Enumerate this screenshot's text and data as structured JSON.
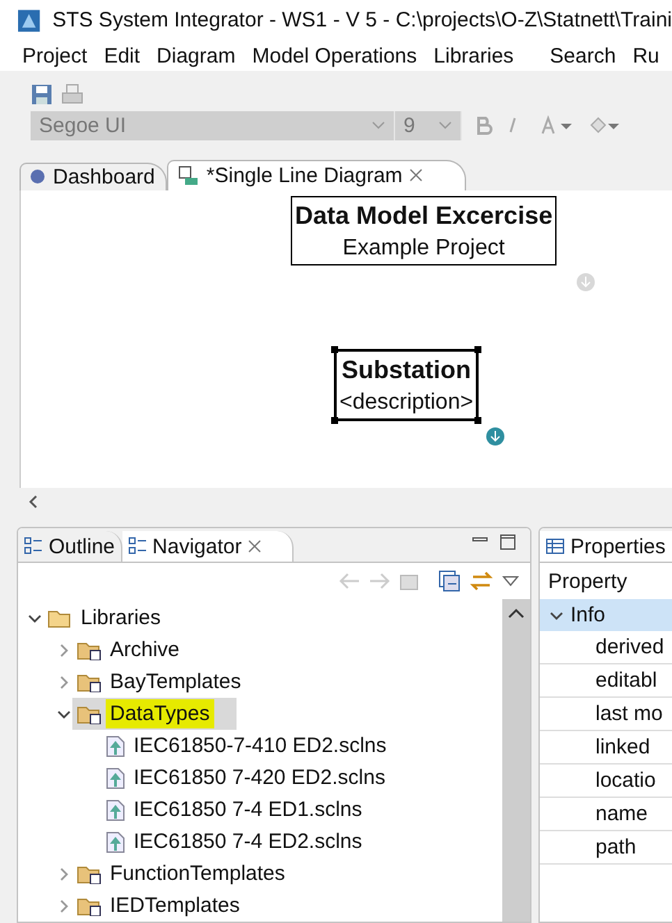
{
  "window": {
    "title": "STS System Integrator - WS1 - V 5 - C:\\projects\\O-Z\\Statnett\\Traini"
  },
  "menu": [
    "Project",
    "Edit",
    "Diagram",
    "Model Operations",
    "Libraries",
    "Search",
    "Ru"
  ],
  "toolbar": {
    "font": "Segoe UI",
    "size": "9"
  },
  "editor_tabs": [
    {
      "label": "Dashboard",
      "selected": false
    },
    {
      "label": "*Single Line Diagram",
      "selected": true
    }
  ],
  "diagram": {
    "nodes": [
      {
        "title": "Data Model Excercise",
        "subtitle": "Example Project",
        "selected": false
      },
      {
        "title": "Substation",
        "subtitle": "<description>",
        "selected": true
      }
    ]
  },
  "navigator": {
    "tabs": [
      {
        "label": "Outline",
        "selected": false
      },
      {
        "label": "Navigator",
        "selected": true
      }
    ],
    "tree": [
      {
        "label": "Libraries",
        "kind": "root",
        "expanded": true,
        "selected": false,
        "highlighted": false,
        "children": [
          {
            "label": "Archive",
            "kind": "folder",
            "expanded": false,
            "selected": false,
            "highlighted": false
          },
          {
            "label": "BayTemplates",
            "kind": "folder",
            "expanded": false,
            "selected": false,
            "highlighted": false
          },
          {
            "label": "DataTypes",
            "kind": "folder",
            "expanded": true,
            "selected": true,
            "highlighted": true,
            "children": [
              {
                "label": "IEC61850-7-410 ED2.sclns",
                "kind": "file",
                "selected": false,
                "highlighted": false
              },
              {
                "label": "IEC61850 7-420 ED2.sclns",
                "kind": "file",
                "selected": false,
                "highlighted": false
              },
              {
                "label": "IEC61850 7-4 ED1.sclns",
                "kind": "file",
                "selected": false,
                "highlighted": false
              },
              {
                "label": "IEC61850 7-4 ED2.sclns",
                "kind": "file",
                "selected": false,
                "highlighted": false
              }
            ]
          },
          {
            "label": "FunctionTemplates",
            "kind": "folder",
            "expanded": false,
            "selected": false,
            "highlighted": false
          },
          {
            "label": "IEDTemplates",
            "kind": "folder",
            "expanded": false,
            "selected": false,
            "highlighted": false
          }
        ]
      }
    ]
  },
  "properties": {
    "title": "Properties",
    "header": "Property",
    "groups": [
      {
        "label": "Info",
        "expanded": true,
        "rows": [
          "derived",
          "editabl",
          "last mo",
          "linked",
          "locatio",
          "name",
          "path"
        ]
      }
    ]
  }
}
